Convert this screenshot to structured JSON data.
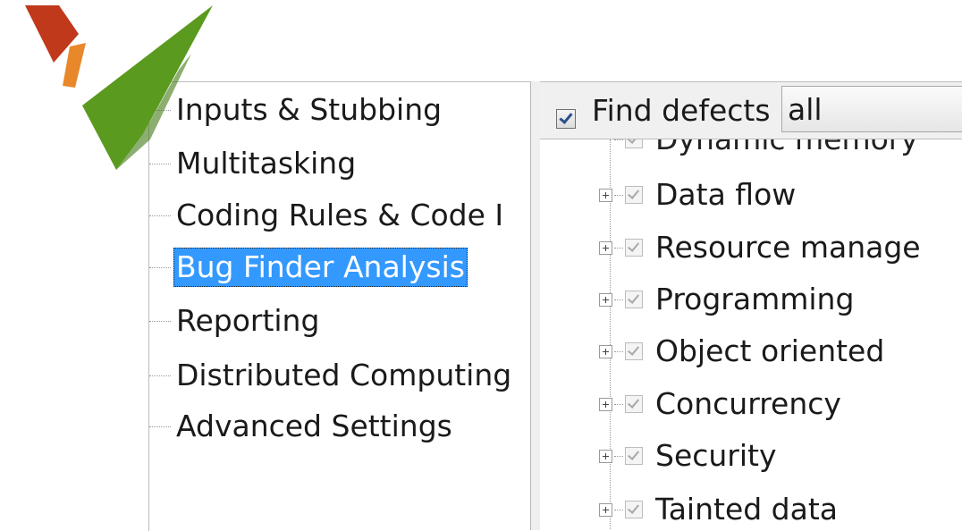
{
  "logo": {
    "icon": "checkmark-logo-icon"
  },
  "left_tree": {
    "items": [
      {
        "label": "Inputs & Stubbing",
        "selected": false
      },
      {
        "label": "Multitasking",
        "selected": false
      },
      {
        "label": "Coding Rules & Code I",
        "selected": false
      },
      {
        "label": "Bug Finder Analysis",
        "selected": true
      },
      {
        "label": "Reporting",
        "selected": false
      },
      {
        "label": "Distributed Computing",
        "selected": false
      },
      {
        "label": "Advanced Settings",
        "selected": false
      }
    ]
  },
  "find_defects": {
    "checked": true,
    "label": "Find defects",
    "selected_value": "all"
  },
  "categories": {
    "partial_item": "Dynamic memory",
    "items": [
      {
        "label": "Data flow",
        "checked": true
      },
      {
        "label": "Resource manage",
        "checked": true
      },
      {
        "label": "Programming",
        "checked": true
      },
      {
        "label": "Object oriented",
        "checked": true
      },
      {
        "label": "Concurrency",
        "checked": true
      },
      {
        "label": "Security",
        "checked": true
      },
      {
        "label": "Tainted data",
        "checked": true
      }
    ]
  },
  "colors": {
    "selection": "#3399ff",
    "logo_green": "#5a9a1e",
    "logo_red": "#c0391b",
    "logo_orange": "#e8882a"
  }
}
